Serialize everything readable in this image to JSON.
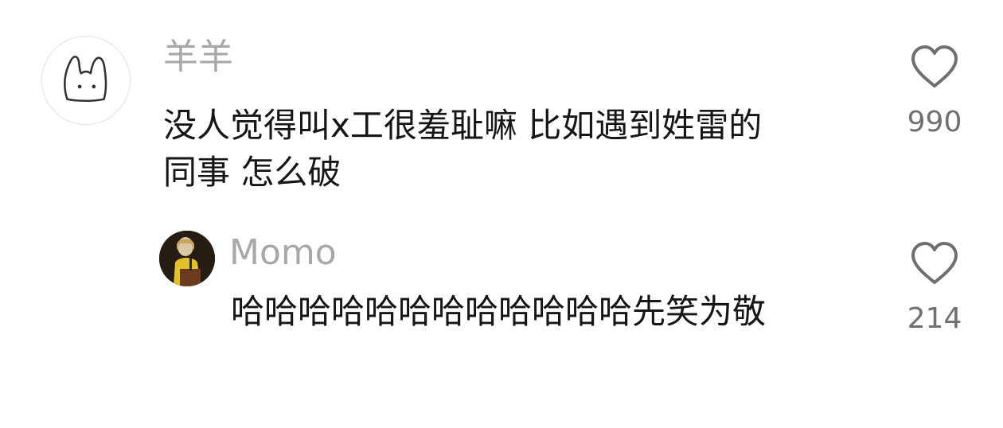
{
  "comments": [
    {
      "username": "羊羊",
      "avatar_icon": "bunny-doodle-icon",
      "text_lines": [
        "没人觉得叫x工很羞耻嘛 比如遇到姓雷的",
        "同事 怎么破"
      ],
      "like_icon": "heart-outline-icon",
      "likes": "990"
    }
  ],
  "reply": {
    "username": "Momo",
    "avatar_icon": "profile-photo",
    "text": "哈哈哈哈哈哈哈哈哈哈哈哈先笑为敬",
    "like_icon": "heart-outline-icon",
    "likes": "214"
  },
  "colors": {
    "username": "#a8a8a8",
    "comment_text": "#161616",
    "like_count": "#707070",
    "heart_stroke": "#6f6f6f"
  }
}
